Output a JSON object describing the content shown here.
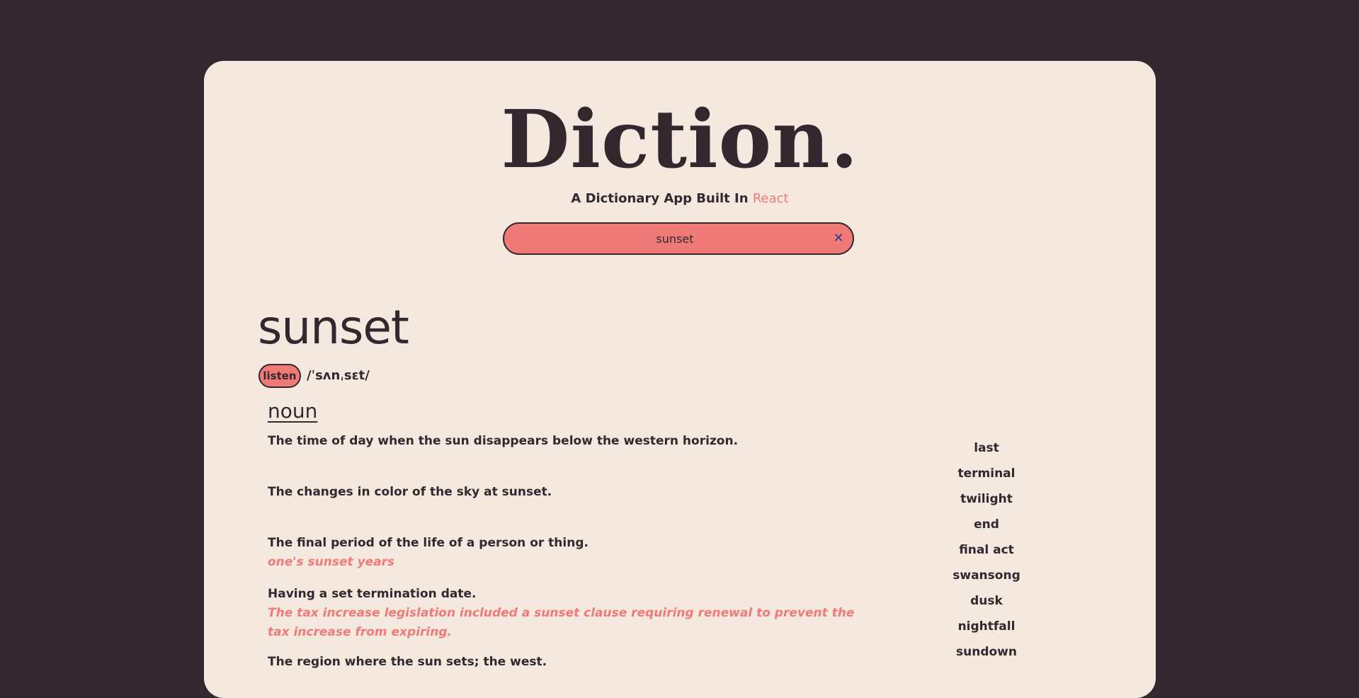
{
  "app": {
    "title": "Diction.",
    "tagline_prefix": "A Dictionary App Built In",
    "tagline_accent": "React"
  },
  "search": {
    "value": "sunset",
    "clear_icon": "close-icon"
  },
  "entry": {
    "word": "sunset",
    "listen_label": "listen",
    "phonetic": "/ˈsʌnˌsɛt/",
    "part_of_speech": "noun",
    "definitions": [
      {
        "text": "The time of day when the sun disappears below the western horizon.",
        "example": ""
      },
      {
        "text": "The changes in color of the sky at sunset.",
        "example": ""
      },
      {
        "text": "The final period of the life of a person or thing.",
        "example": "one's sunset years"
      },
      {
        "text": "Having a set termination date.",
        "example": "The tax increase legislation included a sunset clause requiring renewal to prevent the tax increase from expiring."
      },
      {
        "text": "The region where the sun sets; the west.",
        "example": ""
      }
    ],
    "synonyms": [
      "last",
      "terminal",
      "twilight",
      "end",
      "final act",
      "swansong",
      "dusk",
      "nightfall",
      "sundown"
    ]
  },
  "colors": {
    "background": "#32282d",
    "card": "#f5e9df",
    "accent": "#f07a78",
    "text": "#32282d",
    "clear_icon": "#2f3b8a"
  }
}
